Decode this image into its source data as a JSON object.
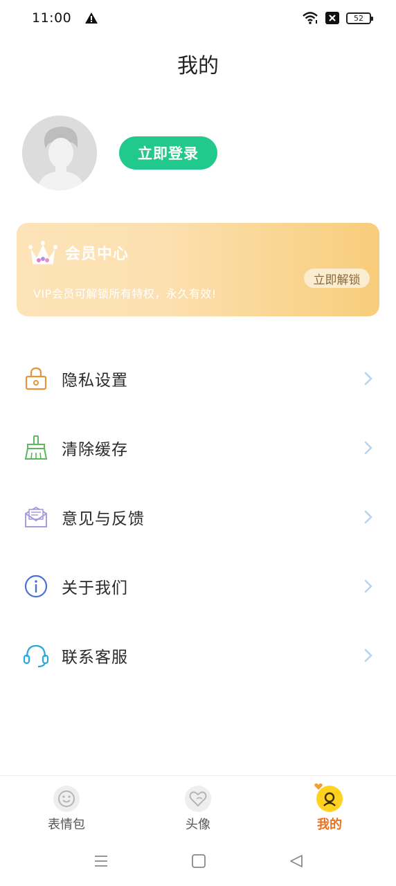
{
  "status_bar": {
    "time": "11:00",
    "battery": "52",
    "icons": [
      "warning-icon",
      "wifi-icon",
      "no-sim-icon",
      "battery-icon"
    ]
  },
  "header": {
    "title": "我的"
  },
  "profile": {
    "login_label": "立即登录"
  },
  "vip": {
    "title": "会员中心",
    "description": "VIP会员可解锁所有特权，永久有效!",
    "unlock_label": "立即解锁"
  },
  "menu": {
    "items": [
      {
        "label": "隐私设置",
        "icon": "lock-icon",
        "color": "#e8943a"
      },
      {
        "label": "清除缓存",
        "icon": "broom-icon",
        "color": "#5cb85c"
      },
      {
        "label": "意见与反馈",
        "icon": "envelope-icon",
        "color": "#a99be0"
      },
      {
        "label": "关于我们",
        "icon": "info-icon",
        "color": "#4a6fd8"
      },
      {
        "label": "联系客服",
        "icon": "headset-icon",
        "color": "#2aa7d8"
      }
    ]
  },
  "tabs": [
    {
      "label": "表情包",
      "icon": "smiley-icon",
      "active": false
    },
    {
      "label": "头像",
      "icon": "heart-icon",
      "active": false
    },
    {
      "label": "我的",
      "icon": "profile-icon",
      "active": true
    }
  ],
  "colors": {
    "accent_green": "#22c98d",
    "active_tab": "#e8731e",
    "chevron": "#b9d3ef"
  }
}
